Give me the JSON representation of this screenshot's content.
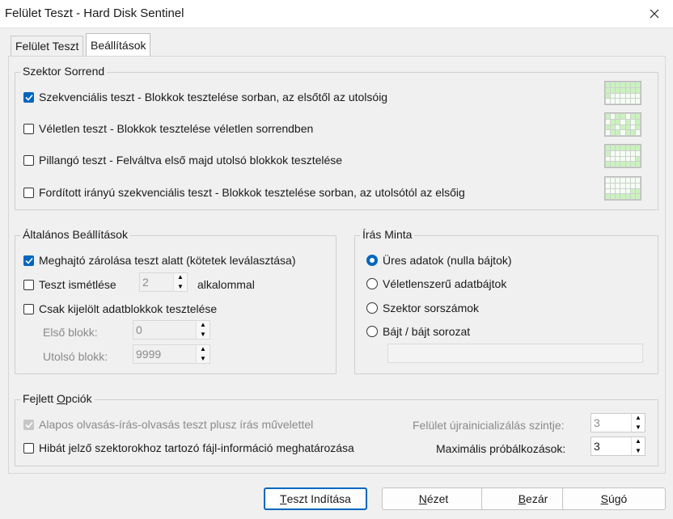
{
  "window": {
    "title": "Felület Teszt - Hard Disk Sentinel"
  },
  "tabs": [
    {
      "label": "Felület Teszt",
      "active": false
    },
    {
      "label": "Beállítások",
      "active": true
    }
  ],
  "sector_order": {
    "legend": "Szektor Sorrend",
    "options": [
      {
        "label": "Szekvenciális teszt - Blokkok tesztelése sorban, az elsőtől az utolsóig",
        "checked": true,
        "icon": "sequential-pattern-icon"
      },
      {
        "label": "Véletlen teszt - Blokkok tesztelése véletlen sorrendben",
        "checked": false,
        "icon": "random-pattern-icon"
      },
      {
        "label": "Pillangó teszt - Felváltva első majd utolsó blokkok tesztelése",
        "checked": false,
        "icon": "butterfly-pattern-icon"
      },
      {
        "label": "Fordított irányú szekvenciális teszt - Blokkok tesztelése sorban, az utolsótól az elsőig",
        "checked": false,
        "icon": "reverse-pattern-icon"
      }
    ]
  },
  "general": {
    "legend": "Általános Beállítások",
    "lock_drive": {
      "label": "Meghajtó zárolása teszt alatt (kötetek leválasztása)",
      "checked": true
    },
    "repeat": {
      "label": "Teszt ismétlése",
      "value": "2",
      "suffix": "alkalommal",
      "checked": false
    },
    "selected_only": {
      "label": "Csak kijelölt adatblokkok tesztelése",
      "checked": false
    },
    "first_block": {
      "label": "Első blokk:",
      "value": "0"
    },
    "last_block": {
      "label": "Utolsó blokk:",
      "value": "9999"
    }
  },
  "write_pattern": {
    "legend": "Írás Minta",
    "options": [
      {
        "label": "Üres adatok (nulla bájtok)",
        "selected": true
      },
      {
        "label": "Véletlenszerű adatbájtok",
        "selected": false
      },
      {
        "label": "Szektor sorszámok",
        "selected": false
      },
      {
        "label": "Bájt / bájt sorozat",
        "selected": false
      }
    ]
  },
  "advanced": {
    "legend_prefix": "Fejlett ",
    "legend_underlined": "O",
    "legend_suffix": "pciók",
    "thorough": {
      "label": "Alapos olvasás-írás-olvasás teszt plusz írás művelettel",
      "checked": true,
      "disabled": true
    },
    "file_info": {
      "label": "Hibát jelző szektorokhoz tartozó fájl-információ meghatározása",
      "checked": false
    },
    "reinit_level": {
      "label": "Felület újrainicializálás szintje:",
      "value": "3"
    },
    "max_retries": {
      "label": "Maximális próbálkozások:",
      "value": "3"
    }
  },
  "buttons": {
    "start": {
      "underlined": "T",
      "rest": "eszt Indítása"
    },
    "view": {
      "underlined": "N",
      "rest": "ézet"
    },
    "close": {
      "underlined": "B",
      "rest": "ezár"
    },
    "help": {
      "underlined": "S",
      "rest": "úgó"
    }
  },
  "colors": {
    "accent": "#0067c0",
    "grid_fill": "#c9f3bd"
  }
}
